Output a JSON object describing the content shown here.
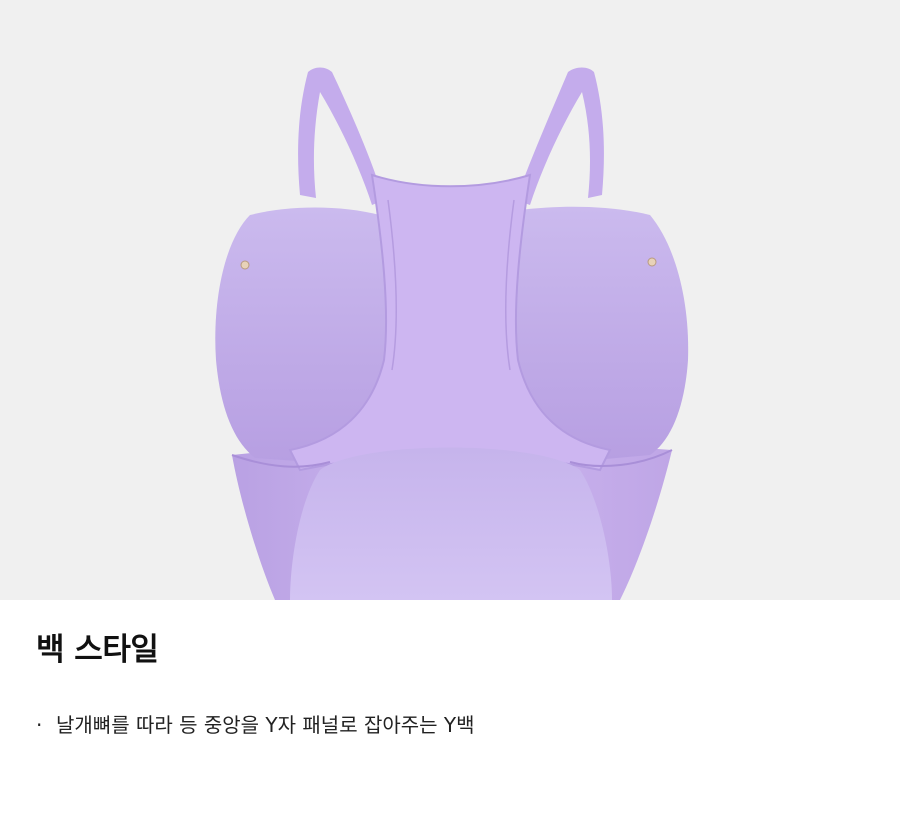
{
  "product_image": {
    "alt": "Y-back swimsuit back view",
    "colors": {
      "background": "#f0f0f0",
      "fabric": "#c9b2ec",
      "fabric_shadow": "#b59ce0",
      "fabric_light": "#dccbf5",
      "lining": "#cfc0ef"
    }
  },
  "title": "백 스타일",
  "bullets": [
    {
      "marker": "·",
      "text": "날개뼈를 따라 등 중앙을 Y자 패널로 잡아주는 Y백"
    }
  ]
}
